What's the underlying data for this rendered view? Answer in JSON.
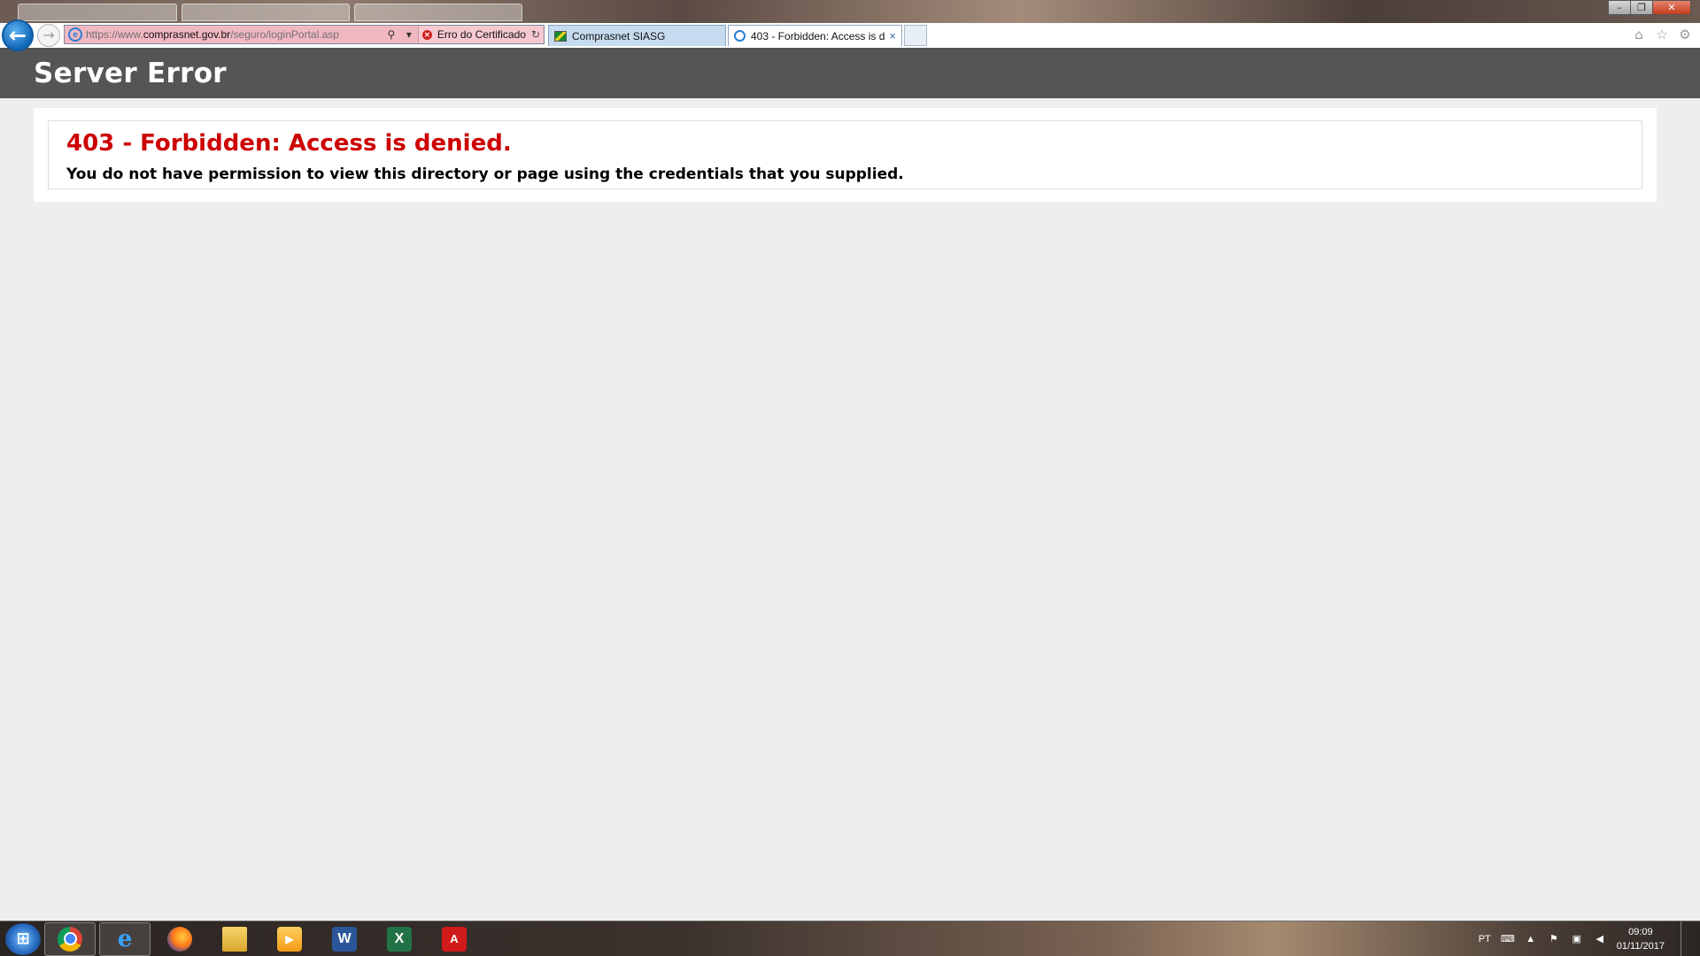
{
  "browser": {
    "address_bar": {
      "url_scheme": "https://www.",
      "url_host": "comprasnet.gov.br",
      "url_path": "/seguro/loginPortal.asp",
      "certificate_error": "Erro do Certificado"
    },
    "tabs": [
      {
        "title": "Comprasnet SIASG",
        "active": false
      },
      {
        "title": "403 - Forbidden: Access is d...",
        "active": true
      }
    ],
    "tab_close_glyph": "×"
  },
  "page": {
    "header": "Server Error",
    "error_title": "403 - Forbidden: Access is denied.",
    "error_message": "You do not have permission to view this directory or page using the credentials that you supplied."
  },
  "taskbar": {
    "language": "PT",
    "time": "09:09",
    "date": "01/11/2017"
  },
  "colors": {
    "header_bg": "#555555",
    "error_red": "#cc0000",
    "page_bg": "#eeeeee"
  },
  "icons": [
    "back-arrow-icon",
    "forward-arrow-icon",
    "ie-icon",
    "search-icon",
    "dropdown-icon",
    "certificate-error-icon",
    "refresh-icon",
    "brazil-flag-icon",
    "home-icon",
    "favorites-star-icon",
    "settings-gear-icon",
    "windows-start-icon",
    "chrome-icon",
    "firefox-icon",
    "folder-icon",
    "media-player-icon",
    "word-icon",
    "excel-icon",
    "acrobat-icon"
  ]
}
